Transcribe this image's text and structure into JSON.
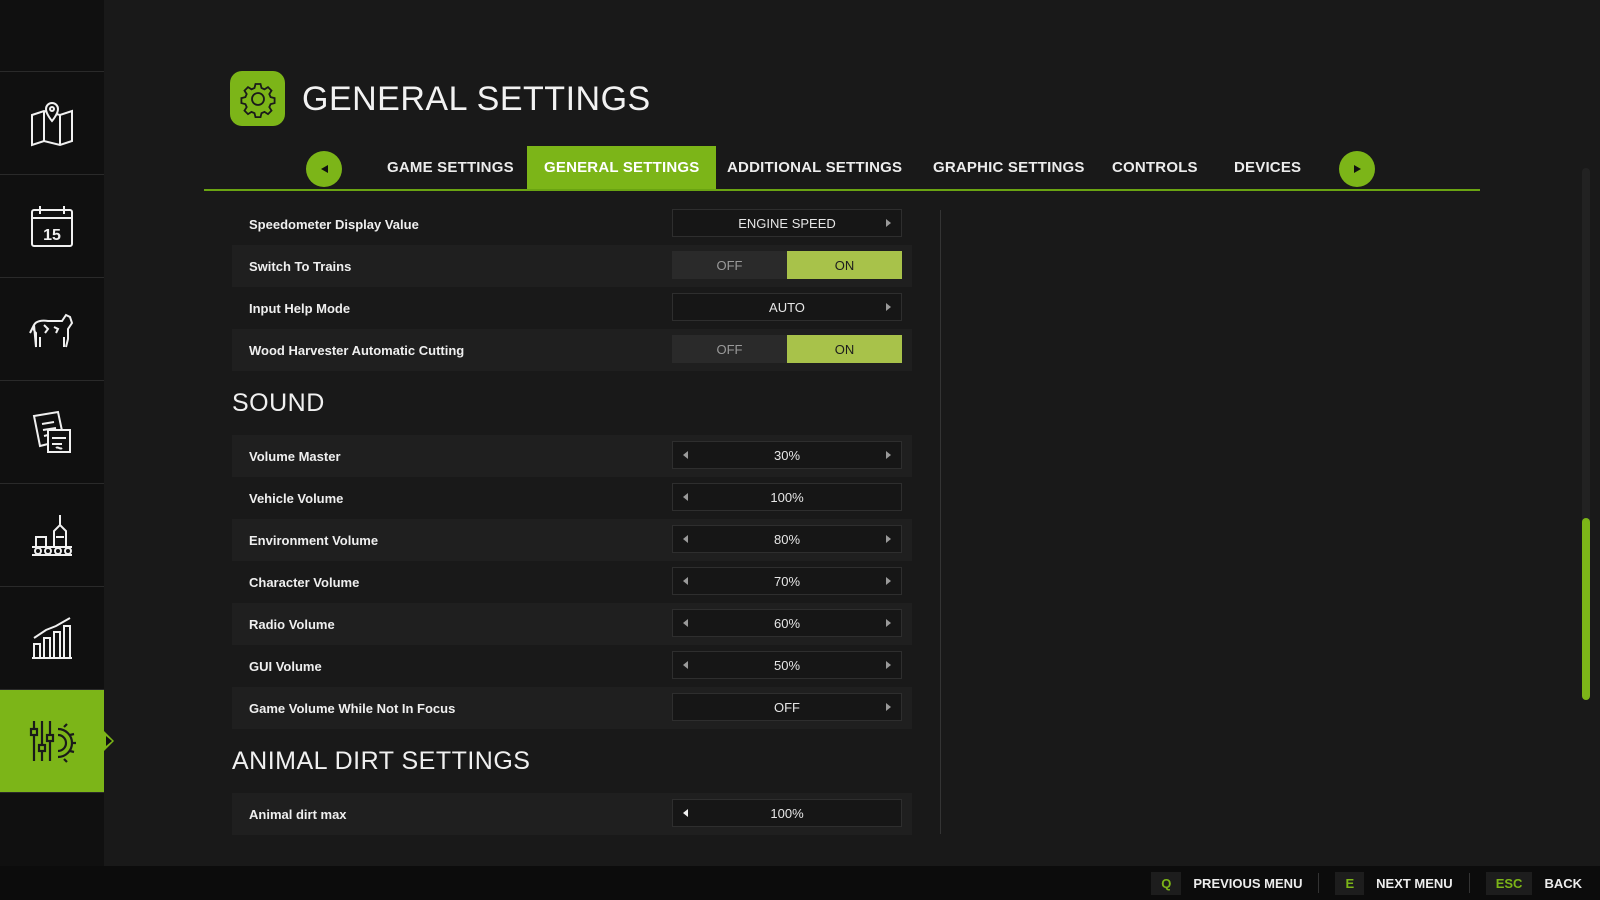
{
  "header": {
    "title": "GENERAL SETTINGS",
    "icon": "gear-icon"
  },
  "colors": {
    "accent": "#7cb518",
    "toggle_on": "#a8c24a",
    "background": "#191919"
  },
  "sidebar": {
    "items": [
      {
        "icon": "map-icon",
        "active": false
      },
      {
        "icon": "calendar-icon",
        "active": false
      },
      {
        "icon": "cow-icon",
        "active": false
      },
      {
        "icon": "contracts-icon",
        "active": false
      },
      {
        "icon": "production-icon",
        "active": false
      },
      {
        "icon": "statistics-icon",
        "active": false
      },
      {
        "icon": "settings-sliders-icon",
        "active": true
      }
    ]
  },
  "tabs": [
    {
      "label": "GAME SETTINGS"
    },
    {
      "label": "GENERAL SETTINGS",
      "active": true
    },
    {
      "label": "ADDITIONAL SETTINGS"
    },
    {
      "label": "GRAPHIC SETTINGS"
    },
    {
      "label": "CONTROLS"
    },
    {
      "label": "DEVICES"
    }
  ],
  "settings": {
    "speedometer": {
      "label": "Speedometer Display Value",
      "value": "ENGINE SPEED"
    },
    "switch_trains": {
      "label": "Switch To Trains",
      "off": "OFF",
      "on": "ON",
      "state": "ON"
    },
    "input_help": {
      "label": "Input Help Mode",
      "value": "AUTO"
    },
    "wood_harvester": {
      "label": "Wood Harvester Automatic Cutting",
      "off": "OFF",
      "on": "ON",
      "state": "ON"
    }
  },
  "sound": {
    "title": "SOUND",
    "rows": [
      {
        "label": "Volume Master",
        "value": "30%"
      },
      {
        "label": "Vehicle Volume",
        "value": "100%"
      },
      {
        "label": "Environment Volume",
        "value": "80%"
      },
      {
        "label": "Character Volume",
        "value": "70%"
      },
      {
        "label": "Radio Volume",
        "value": "60%"
      },
      {
        "label": "GUI Volume",
        "value": "50%"
      },
      {
        "label": "Game Volume While Not In Focus",
        "value": "OFF"
      }
    ]
  },
  "animal_dirt": {
    "title": "ANIMAL DIRT SETTINGS",
    "rows": [
      {
        "label": "Animal dirt max",
        "value": "100%"
      }
    ]
  },
  "footer": {
    "hints": [
      {
        "key": "Q",
        "label": "PREVIOUS MENU"
      },
      {
        "key": "E",
        "label": "NEXT MENU"
      },
      {
        "key": "ESC",
        "label": "BACK"
      }
    ]
  }
}
